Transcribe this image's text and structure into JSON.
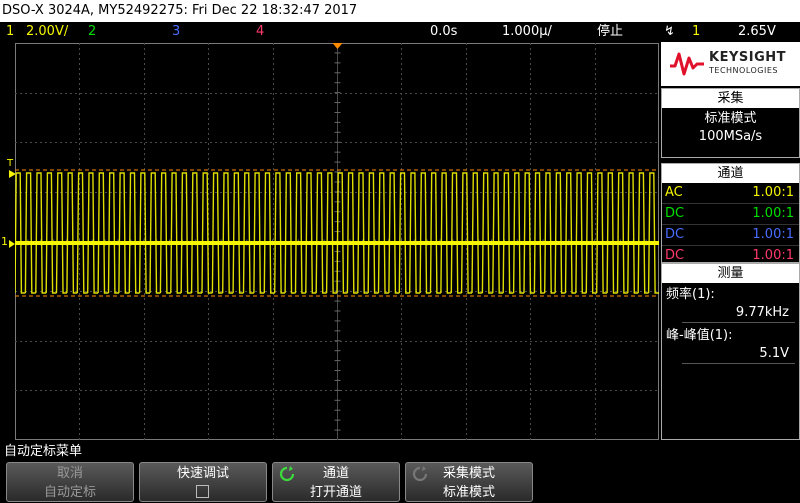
{
  "title_bar": "DSO-X 3024A, MY52492275: Fri Dec 22 18:32:47 2017",
  "status": {
    "ch1_num": "1",
    "ch1_scale": "2.00V/",
    "ch2_num": "2",
    "ch3_num": "3",
    "ch4_num": "4",
    "time_delay": "0.0s",
    "time_scale": "1.000µ/",
    "run_state": "停止",
    "trig_num": "1",
    "trig_level": "2.65V"
  },
  "colors": {
    "ch1": "#f6f600",
    "ch2": "#00e000",
    "ch3": "#4a6cff",
    "ch4": "#ff3a6a",
    "trigger": "#ff8c00"
  },
  "logo": {
    "name": "KEYSIGHT",
    "sub": "TECHNOLOGIES"
  },
  "acquire": {
    "header": "采集",
    "mode": "标准模式",
    "rate": "100MSa/s"
  },
  "channels": {
    "header": "通道",
    "rows": [
      {
        "coupling": "AC",
        "ratio": "1.00:1"
      },
      {
        "coupling": "DC",
        "ratio": "1.00:1"
      },
      {
        "coupling": "DC",
        "ratio": "1.00:1"
      },
      {
        "coupling": "DC",
        "ratio": "1.00:1"
      }
    ]
  },
  "measure": {
    "header": "测量",
    "freq_label": "频率(1):",
    "freq_value": "9.77kHz",
    "pp_label": "峰-峰值(1):",
    "pp_value": "5.1V"
  },
  "markers": {
    "trigger_level": "T",
    "ch1_ground": "1"
  },
  "menu": {
    "title": "自动定标菜单",
    "keys": [
      {
        "line1": "取消",
        "line2": "自动定标"
      },
      {
        "line1": "快速调试",
        "line2": ""
      },
      {
        "line1": "通道",
        "line2": "打开通道"
      },
      {
        "line1": "采集模式",
        "line2": "标准模式"
      }
    ]
  }
}
